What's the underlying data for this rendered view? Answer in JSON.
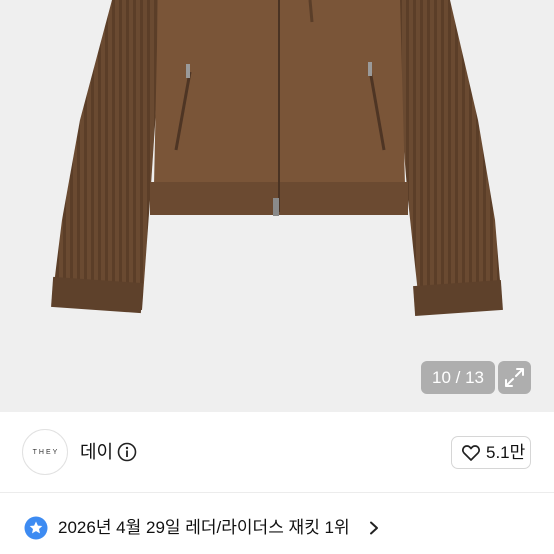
{
  "gallery": {
    "counter": "10 / 13",
    "current": 10,
    "total": 13
  },
  "seller": {
    "logo_text": "THEY",
    "name": "데이",
    "likes": "5.1만"
  },
  "ranking": {
    "text": "2026년 4월 29일 레더/라이더스 재킷 1위"
  },
  "colors": {
    "jacket_brown": "#6f4d33",
    "rank_star_blue": "#3d8bf2"
  },
  "icons": {
    "expand": "expand-icon",
    "info": "info-icon",
    "heart": "heart-icon",
    "star": "star-badge-icon",
    "chevron": "chevron-right-icon"
  }
}
